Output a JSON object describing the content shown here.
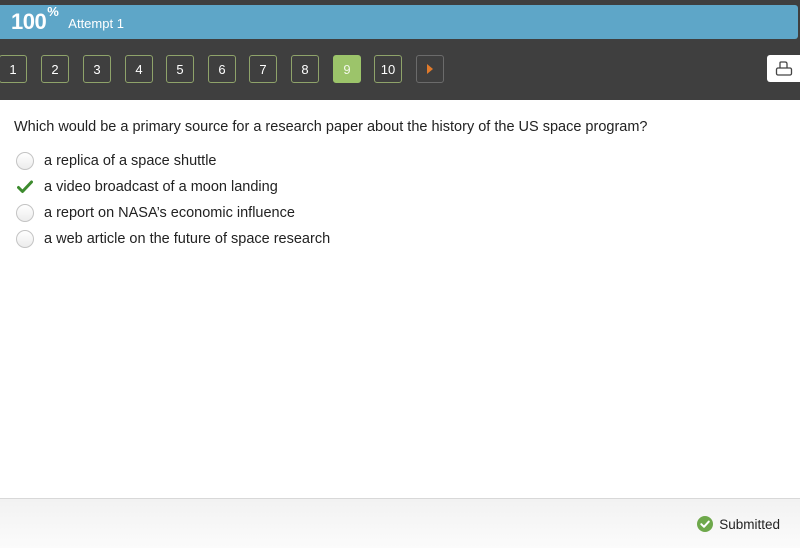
{
  "header": {
    "score_value": "100",
    "score_unit": "%",
    "attempt_label": "Attempt 1",
    "colors": {
      "score_bar": "#5ea6c8",
      "frame": "#3f3f3f"
    }
  },
  "navigation": {
    "questions": [
      {
        "label": "1",
        "state": "answered"
      },
      {
        "label": "2",
        "state": "answered"
      },
      {
        "label": "3",
        "state": "answered"
      },
      {
        "label": "4",
        "state": "answered"
      },
      {
        "label": "5",
        "state": "answered"
      },
      {
        "label": "6",
        "state": "answered"
      },
      {
        "label": "7",
        "state": "answered"
      },
      {
        "label": "8",
        "state": "answered"
      },
      {
        "label": "9",
        "state": "current"
      },
      {
        "label": "10",
        "state": "answered"
      }
    ],
    "current_question": "9",
    "next_icon": "play-triangle-icon",
    "print_icon": "printer-icon",
    "colors": {
      "button_border": "#8fa36a",
      "active_fill": "#9cc46a",
      "next_arrow": "#e07a2b"
    }
  },
  "question": {
    "prompt": "Which would be a primary source for a research paper about the history of the US space program?",
    "options": [
      {
        "label": "a replica of a space shuttle",
        "selected": false,
        "icon": "radio-empty-icon"
      },
      {
        "label": "a video broadcast of a moon landing",
        "selected": true,
        "icon": "checkmark-icon"
      },
      {
        "label": "a report on NASA’s economic influence",
        "selected": false,
        "icon": "radio-empty-icon"
      },
      {
        "label": "a web article on the future of space research",
        "selected": false,
        "icon": "radio-empty-icon"
      }
    ],
    "check_color": "#3d8b2e"
  },
  "footer": {
    "status_label": "Submitted",
    "status_icon": "check-circle-icon",
    "status_color": "#6ea84b"
  }
}
